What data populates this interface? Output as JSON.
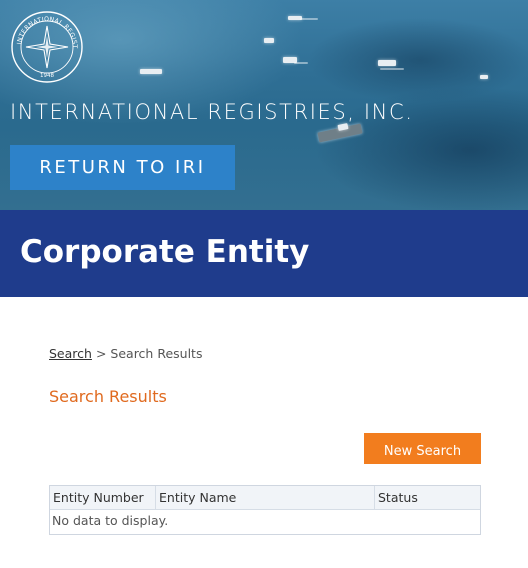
{
  "header": {
    "logo_text": "INTERNATIONAL REGISTRIES",
    "logo_year": "1948",
    "company_name": "INTERNATIONAL REGISTRIES, INC.",
    "return_button_label": "RETURN TO IRI"
  },
  "page_title": "Corporate Entity",
  "breadcrumb": {
    "link": "Search",
    "separator": ">",
    "current": "Search Results"
  },
  "section_title": "Search Results",
  "new_search_label": "New Search",
  "results_table": {
    "columns": [
      "Entity Number",
      "Entity Name",
      "Status"
    ],
    "empty_message": "No data to display."
  },
  "colors": {
    "banner_blue": "#1f3c8c",
    "button_blue": "#2d82c9",
    "accent_orange": "#f27d1e",
    "section_title_orange": "#e06a1f"
  }
}
